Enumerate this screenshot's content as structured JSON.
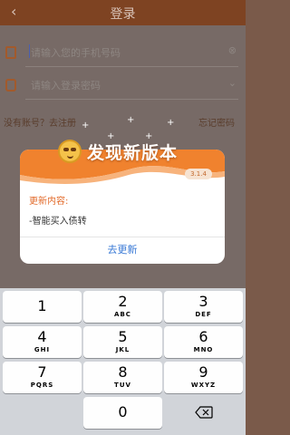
{
  "nav": {
    "back": "‹",
    "title": "登录"
  },
  "login": {
    "phone_placeholder": "请输入您的手机号码",
    "password_placeholder": "请输入登录密码",
    "password_toggle": "⌄",
    "phone_clear": "⊗",
    "register_link": "没有账号？去注册",
    "forgot_link": "忘记密码"
  },
  "dialog": {
    "title": "发现新版本",
    "version": "3.1.4",
    "content_title": "更新内容:",
    "content_item": "-智能买入债转",
    "update_button": "去更新"
  },
  "keyboard": {
    "keys": [
      {
        "num": "1",
        "letters": ""
      },
      {
        "num": "2",
        "letters": "ABC"
      },
      {
        "num": "3",
        "letters": "DEF"
      },
      {
        "num": "4",
        "letters": "GHI"
      },
      {
        "num": "5",
        "letters": "JKL"
      },
      {
        "num": "6",
        "letters": "MNO"
      },
      {
        "num": "7",
        "letters": "PQRS"
      },
      {
        "num": "8",
        "letters": "TUV"
      },
      {
        "num": "9",
        "letters": "WXYZ"
      },
      {
        "num": "0",
        "letters": ""
      }
    ]
  },
  "colors": {
    "accent": "#f0822e",
    "link": "#3a7ad6",
    "content_title": "#e26a2a"
  }
}
